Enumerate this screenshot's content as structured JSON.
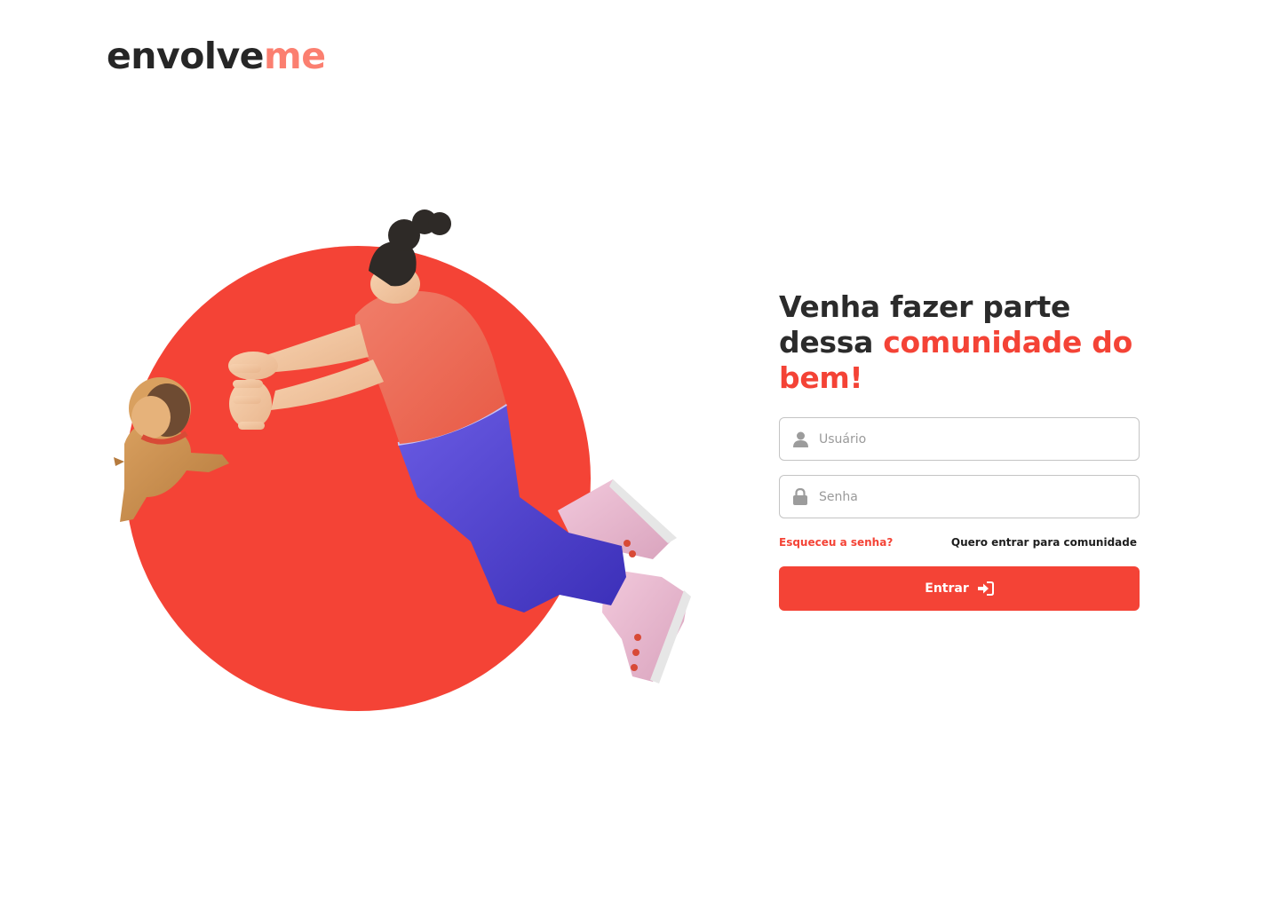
{
  "brand": {
    "name_dark": "envolve",
    "name_accent": "me",
    "accent_color": "#fb7f70"
  },
  "colors": {
    "primary": "#f44336",
    "text_dark": "#2b2b2b",
    "input_border": "#c4c4c4"
  },
  "headline": {
    "line_plain": "Venha fazer parte dessa ",
    "line_accent": "comunidade do bem!"
  },
  "form": {
    "username": {
      "placeholder": "Usuário",
      "icon": "user-icon"
    },
    "password": {
      "placeholder": "Senha",
      "icon": "lock-icon"
    },
    "forgot_link": "Esqueceu a senha?",
    "join_link": "Quero entrar para comunidade",
    "submit": {
      "label": "Entrar",
      "icon": "sign-in-icon"
    }
  },
  "hero": {
    "illustration": "woman-jumping-to-catch-puppy"
  }
}
